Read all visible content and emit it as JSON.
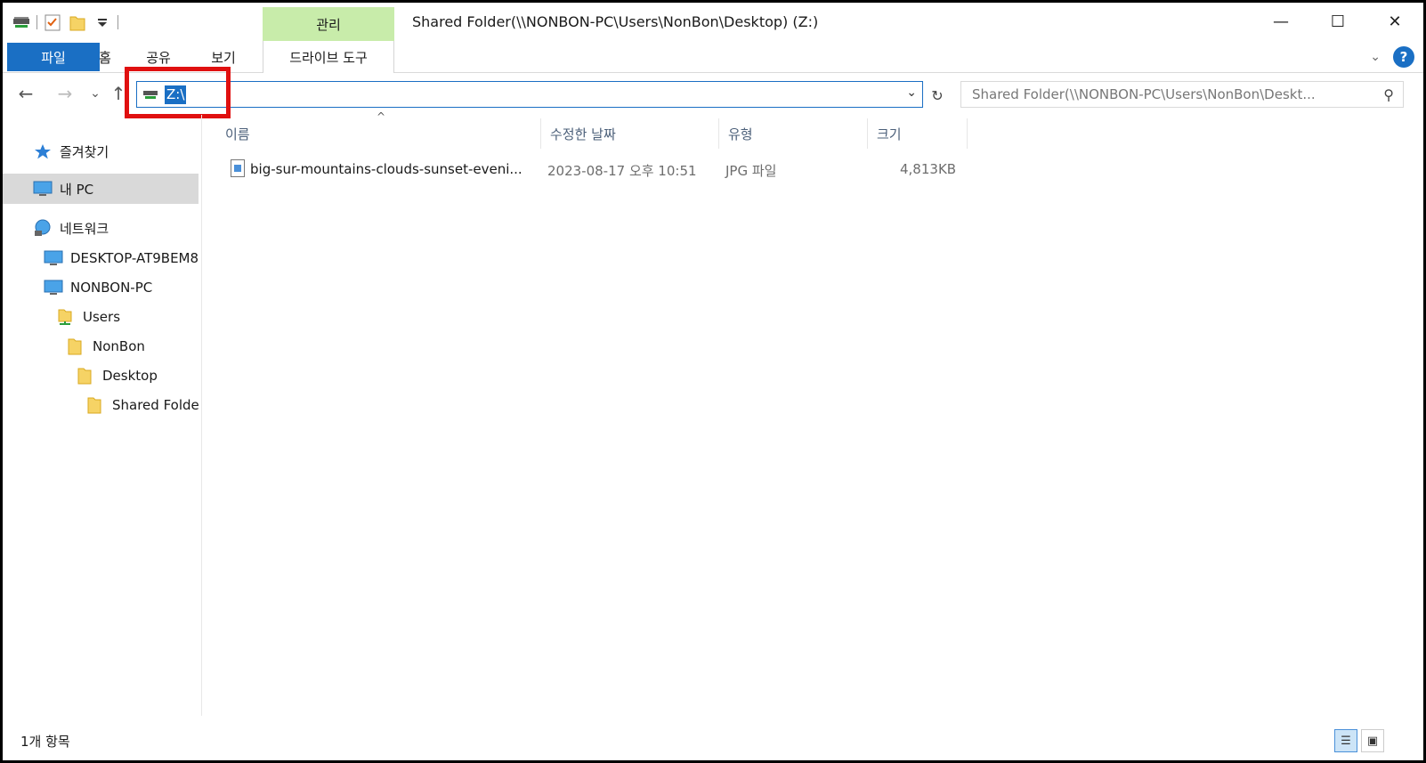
{
  "window": {
    "title": "Shared Folder(\\\\NONBON-PC\\Users\\NonBon\\Desktop) (Z:)",
    "context_tab_top": "관리",
    "controls": {
      "minimize": "—",
      "maximize": "☐",
      "close": "✕"
    }
  },
  "ribbon": {
    "tabs": {
      "file": "파일",
      "home": "홈",
      "share": "공유",
      "view": "보기",
      "drive_tools": "드라이브 도구"
    },
    "expand_icon": "chevron-down-icon",
    "help_label": "?"
  },
  "nav": {
    "back": "←",
    "forward": "→",
    "recent": "⌄",
    "up": "↑",
    "address": "Z:\\",
    "search_placeholder": "Shared Folder(\\\\NONBON-PC\\Users\\NonBon\\Deskt..."
  },
  "sidebar": {
    "items": [
      {
        "label": "즐겨찾기",
        "icon": "star-icon"
      },
      {
        "label": "내 PC",
        "icon": "computer-icon"
      },
      {
        "label": "네트워크",
        "icon": "network-icon"
      },
      {
        "label": "DESKTOP-AT9BEM8",
        "icon": "computer-icon"
      },
      {
        "label": "NONBON-PC",
        "icon": "computer-icon"
      },
      {
        "label": "Users",
        "icon": "shared-folder-icon"
      },
      {
        "label": "NonBon",
        "icon": "folder-icon"
      },
      {
        "label": "Desktop",
        "icon": "folder-icon"
      },
      {
        "label": "Shared Folder",
        "icon": "folder-icon"
      }
    ]
  },
  "columns": {
    "name": "이름",
    "modified": "수정한 날짜",
    "type": "유형",
    "size": "크기"
  },
  "files": [
    {
      "name": "big-sur-mountains-clouds-sunset-eveni...",
      "modified": "2023-08-17 오후 10:51",
      "type": "JPG 파일",
      "size": "4,813KB"
    }
  ],
  "status": {
    "count": "1개 항목"
  },
  "colors": {
    "accent": "#1a6fc4",
    "manage_tab": "#c8ecaa",
    "highlight": "#e01010"
  }
}
